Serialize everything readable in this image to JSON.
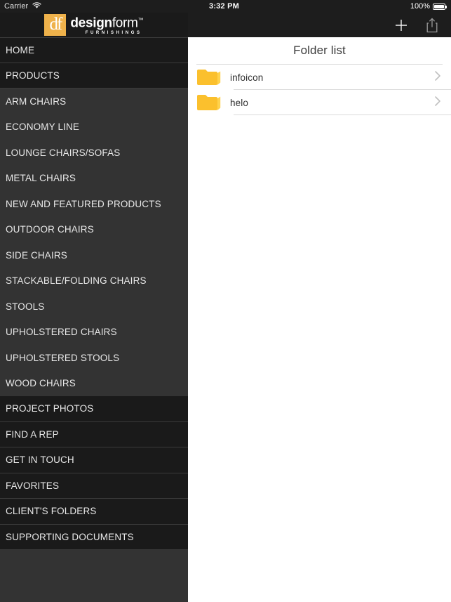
{
  "sidebar": {
    "status": {
      "carrier": "Carrier",
      "wifi_icon": "wifi-icon"
    },
    "logo": {
      "mark_glyph": "df",
      "name_bold": "design",
      "name_light": "form",
      "trademark": "™",
      "tagline": "FURNISHINGS",
      "mark_color": "#efb24b"
    },
    "items": [
      {
        "label": "HOME",
        "style": "dark"
      },
      {
        "label": "PRODUCTS",
        "style": "dark"
      },
      {
        "label": "ARM CHAIRS",
        "style": "sub"
      },
      {
        "label": "ECONOMY LINE",
        "style": "sub"
      },
      {
        "label": "LOUNGE CHAIRS/SOFAS",
        "style": "sub"
      },
      {
        "label": "METAL CHAIRS",
        "style": "sub"
      },
      {
        "label": "NEW AND FEATURED PRODUCTS",
        "style": "sub"
      },
      {
        "label": "OUTDOOR CHAIRS",
        "style": "sub"
      },
      {
        "label": "SIDE CHAIRS",
        "style": "sub"
      },
      {
        "label": "STACKABLE/FOLDING CHAIRS",
        "style": "sub"
      },
      {
        "label": "STOOLS",
        "style": "sub"
      },
      {
        "label": "UPHOLSTERED CHAIRS",
        "style": "sub"
      },
      {
        "label": "UPHOLSTERED STOOLS",
        "style": "sub"
      },
      {
        "label": "WOOD CHAIRS",
        "style": "sub"
      },
      {
        "label": "PROJECT PHOTOS",
        "style": "dark"
      },
      {
        "label": "FIND A REP",
        "style": "dark"
      },
      {
        "label": "GET IN TOUCH",
        "style": "dark"
      },
      {
        "label": "FAVORITES",
        "style": "dark"
      },
      {
        "label": "CLIENT'S FOLDERS",
        "style": "dark"
      },
      {
        "label": "SUPPORTING DOCUMENTS",
        "style": "dark"
      }
    ]
  },
  "main": {
    "status": {
      "time": "3:32 PM",
      "battery_percent": "100%",
      "battery_icon": "battery-full-icon"
    },
    "toolbar": {
      "add_icon": "plus-icon",
      "share_icon": "share-icon"
    },
    "title": "Folder list",
    "folders": [
      {
        "name": "infoicon",
        "icon": "folder-icon",
        "chevron": "chevron-right-icon"
      },
      {
        "name": "helo",
        "icon": "folder-icon",
        "chevron": "chevron-right-icon"
      }
    ],
    "folder_color": "#fbc02d"
  }
}
